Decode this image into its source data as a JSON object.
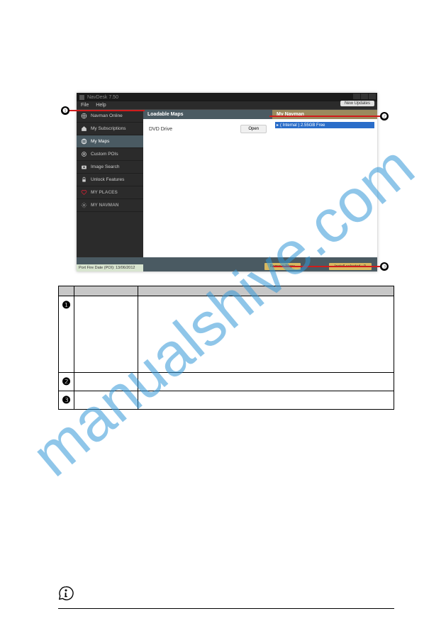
{
  "watermark": "manualshive.com",
  "app": {
    "title": "NavDesk 7.50",
    "menu": {
      "file": "File",
      "help": "Help"
    },
    "updateBtn": "New Updates"
  },
  "sidebar": {
    "items": [
      {
        "name": "navman-online",
        "label": "Navman Online"
      },
      {
        "name": "my-subscriptions",
        "label": "My Subscriptions"
      },
      {
        "name": "my-maps",
        "label": "My Maps"
      },
      {
        "name": "custom-pois",
        "label": "Custom POIs"
      },
      {
        "name": "image-search",
        "label": "Image Search"
      },
      {
        "name": "unlock-features",
        "label": "Unlock Features"
      }
    ],
    "places": "MY PLACES",
    "navman": "MY NAVMAN"
  },
  "mid": {
    "header": "Loadable Maps",
    "dvd": "DVD Drive",
    "openBtn": "Open"
  },
  "right": {
    "header": "My Navman",
    "tree": "( Internal ) 2.55GB Free"
  },
  "footer": {
    "status": "Port Fire Date (POI): 13/06/2012",
    "remove": "Remove Maps",
    "install": "Install selected : 0"
  },
  "callouts": {
    "c1": "❶",
    "c2": "❷",
    "c3": "❸"
  },
  "table": {
    "r1": "❶",
    "r2": "❷",
    "r3": "❸"
  }
}
